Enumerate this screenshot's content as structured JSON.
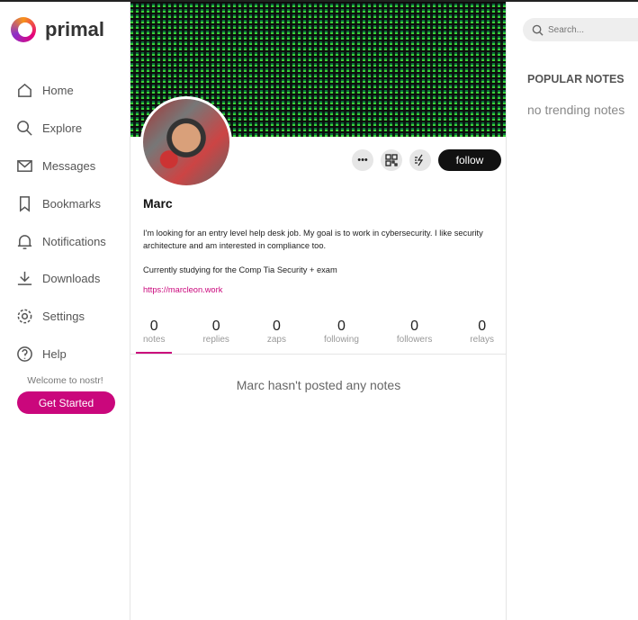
{
  "app": {
    "name": "primal"
  },
  "sidebar": {
    "items": [
      {
        "label": "Home",
        "icon": "home-icon"
      },
      {
        "label": "Explore",
        "icon": "search-icon"
      },
      {
        "label": "Messages",
        "icon": "mail-icon"
      },
      {
        "label": "Bookmarks",
        "icon": "bookmark-icon"
      },
      {
        "label": "Notifications",
        "icon": "bell-icon"
      },
      {
        "label": "Downloads",
        "icon": "download-icon"
      },
      {
        "label": "Settings",
        "icon": "gear-icon"
      },
      {
        "label": "Help",
        "icon": "help-icon"
      }
    ],
    "welcome": "Welcome to nostr!",
    "get_started": "Get Started"
  },
  "profile": {
    "more": "•••",
    "follow": "follow",
    "name": "Marc",
    "bio1": "I'm looking for an entry level help desk job. My goal is to work in cybersecurity. I like security architecture and am interested in compliance too.",
    "bio2": "Currently studying for the Comp Tia Security + exam",
    "website": "https://marcleon.work",
    "stats": [
      {
        "n": "0",
        "l": "notes"
      },
      {
        "n": "0",
        "l": "replies"
      },
      {
        "n": "0",
        "l": "zaps"
      },
      {
        "n": "0",
        "l": "following"
      },
      {
        "n": "0",
        "l": "followers"
      },
      {
        "n": "0",
        "l": "relays"
      }
    ],
    "empty": "Marc hasn't posted any notes"
  },
  "right": {
    "search_placeholder": "Search...",
    "popular": "POPULAR NOTES",
    "no_trending": "no trending notes"
  },
  "colors": {
    "accent": "#ca077c"
  }
}
